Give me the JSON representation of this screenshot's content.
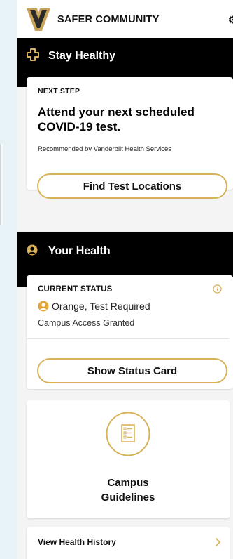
{
  "header": {
    "brand": "SAFER COMMUNITY"
  },
  "stay_healthy": {
    "title": "Stay Healthy",
    "card": {
      "eyebrow": "NEXT STEP",
      "headline": "Attend your next scheduled COVID-19 test.",
      "recommended": "Recommended by Vanderbilt Health Services",
      "button": "Find Test Locations"
    }
  },
  "your_health": {
    "title": "Your Health",
    "card": {
      "eyebrow": "CURRENT STATUS",
      "status": "Orange, Test Required",
      "access": "Campus Access Granted",
      "button": "Show Status Card"
    }
  },
  "guidelines": {
    "line1": "Campus",
    "line2": "Guidelines"
  },
  "history": {
    "label": "View Health History"
  },
  "colors": {
    "accent": "#d8b25a",
    "bar": "#000000",
    "status_orange": "#e0a63a"
  },
  "icons": [
    "vanderbilt-logo",
    "gear-icon",
    "medical-cross-icon",
    "user-circle-icon",
    "info-icon",
    "guidelines-doc-icon",
    "chevron-right-icon"
  ]
}
